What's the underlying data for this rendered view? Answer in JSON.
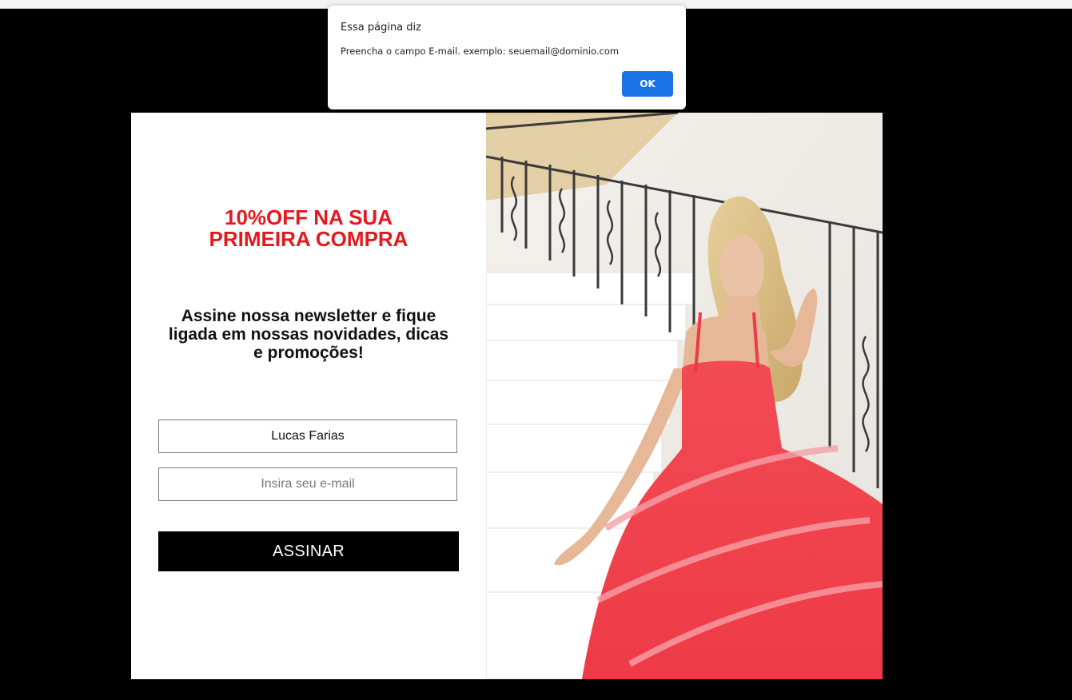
{
  "alert": {
    "title": "Essa página diz",
    "message": "Preencha o campo E-mail. exemplo: seuemail@dominio.com",
    "ok_label": "OK"
  },
  "popup": {
    "headline": "10%OFF NA SUA PRIMEIRA COMPRA",
    "subtitle": "Assine nossa newsletter e fique ligada em nossas novidades, dicas e promoções!",
    "name_value": "Lucas Farias",
    "email_value": "",
    "email_placeholder": "Insira seu e-mail",
    "submit_label": "ASSINAR"
  },
  "colors": {
    "accent_red": "#e5181f",
    "button_black": "#000000",
    "alert_blue": "#1a73e8",
    "dress_coral": "#f0454f"
  }
}
